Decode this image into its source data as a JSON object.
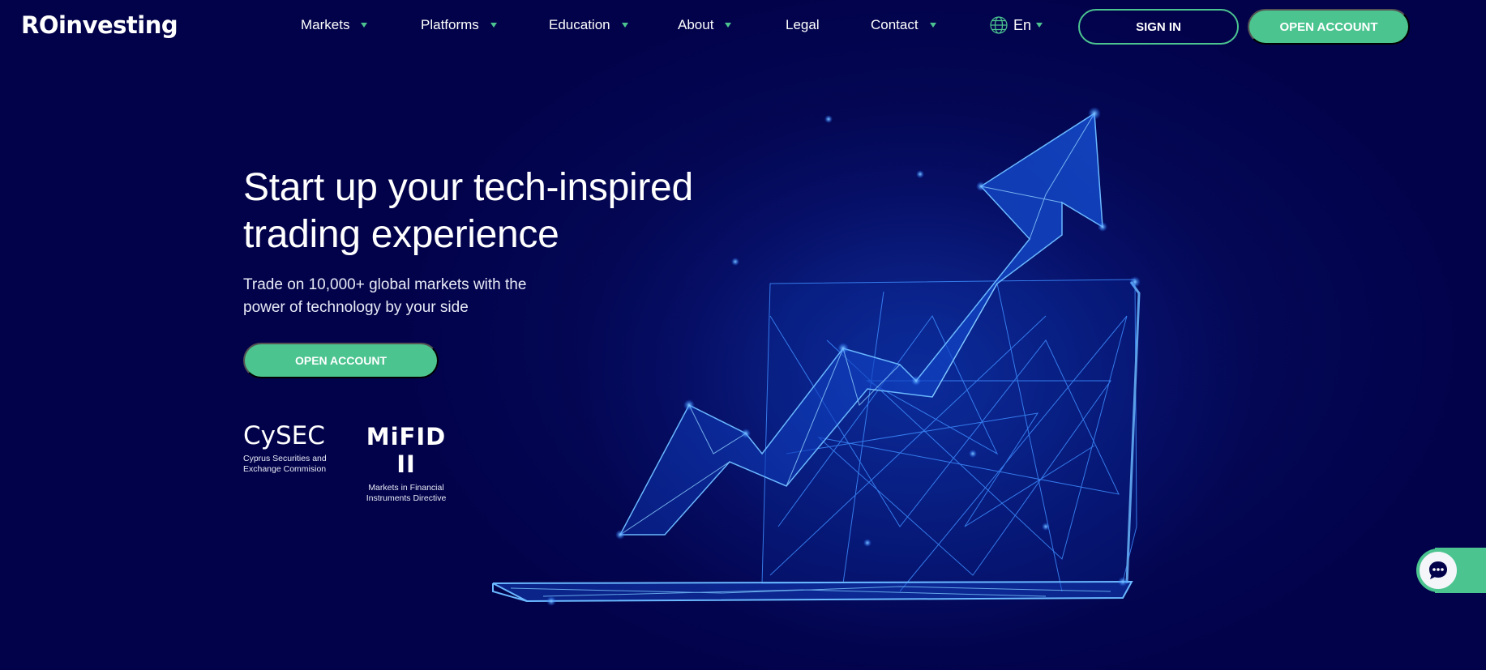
{
  "brand": {
    "logo_text": "ROinvesting",
    "accent_color": "#4cc490",
    "background_color": "#02024a"
  },
  "nav": {
    "items": [
      {
        "label": "Markets",
        "has_dropdown": true
      },
      {
        "label": "Platforms",
        "has_dropdown": true
      },
      {
        "label": "Education",
        "has_dropdown": true
      },
      {
        "label": "About",
        "has_dropdown": true
      },
      {
        "label": "Legal",
        "has_dropdown": false
      },
      {
        "label": "Contact",
        "has_dropdown": true
      }
    ],
    "language": {
      "icon": "globe-icon",
      "selected": "En"
    },
    "sign_in_label": "SIGN IN",
    "open_account_label": "OPEN ACCOUNT"
  },
  "hero": {
    "title_line1": "Start up your tech-inspired",
    "title_line2": "trading experience",
    "subtitle_line1": "Trade on 10,000+ global markets with the",
    "subtitle_line2": "power of technology by your side",
    "cta_label": "OPEN ACCOUNT",
    "illustration": "wireframe-laptop-rising-arrow"
  },
  "badges": [
    {
      "title": "CySEC",
      "desc_line1": "Cyprus Securities and",
      "desc_line2": "Exchange Commision"
    },
    {
      "title": "MiFID II",
      "desc_line1": "Markets in Financial",
      "desc_line2": "Instruments Directive"
    }
  ],
  "chat": {
    "icon": "chat-bubble-icon"
  }
}
